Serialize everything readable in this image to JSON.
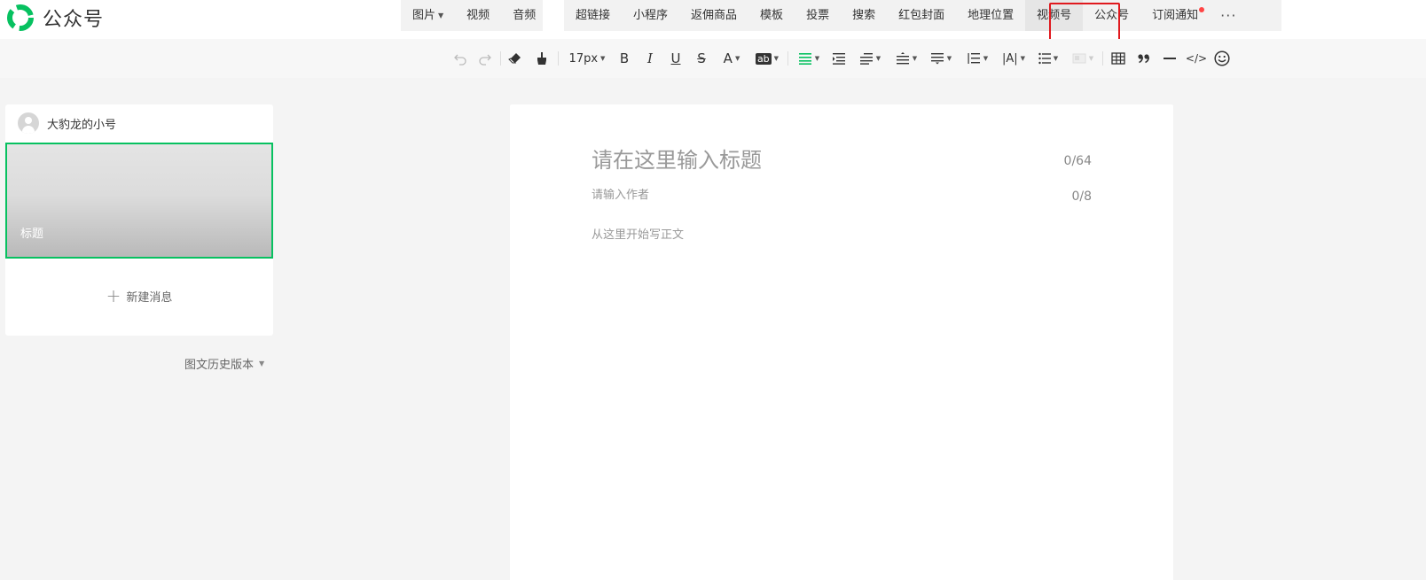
{
  "app": {
    "name": "公众号"
  },
  "insert_menu": {
    "group1": [
      {
        "label": "图片",
        "has_dropdown": true
      },
      {
        "label": "视频",
        "has_dropdown": false
      },
      {
        "label": "音频",
        "has_dropdown": false
      }
    ],
    "group2": [
      {
        "label": "超链接"
      },
      {
        "label": "小程序"
      },
      {
        "label": "返佣商品"
      },
      {
        "label": "模板"
      },
      {
        "label": "投票"
      },
      {
        "label": "搜索"
      },
      {
        "label": "红包封面"
      },
      {
        "label": "地理位置"
      },
      {
        "label": "视频号",
        "active": true
      },
      {
        "label": "公众号"
      },
      {
        "label": "订阅通知",
        "badge": "red-dot"
      }
    ],
    "more_label": "···"
  },
  "toolbar": {
    "font_size": "17px",
    "icons": [
      "undo-icon",
      "redo-icon",
      "eraser-icon",
      "format-brush-icon",
      "bold-icon",
      "italic-icon",
      "underline-icon",
      "strikethrough-icon",
      "font-color-icon",
      "background-color-icon",
      "align-icon",
      "indent-icon",
      "first-line-indent-icon",
      "paragraph-spacing-before-icon",
      "paragraph-spacing-after-icon",
      "line-height-icon",
      "letter-spacing-icon",
      "list-icon",
      "image-layout-icon",
      "table-icon",
      "quote-icon",
      "divider-icon",
      "code-icon",
      "emoji-icon"
    ],
    "labels": {
      "bold": "B",
      "italic": "I",
      "underline": "U",
      "strike": "S",
      "font_color": "A",
      "bg_color": "ab",
      "letter_spacing": "|A|",
      "code": "</>"
    },
    "accent_color": "#07c160"
  },
  "account": {
    "name": "大豹龙的小号"
  },
  "article": {
    "title": "标题"
  },
  "new_message": {
    "label": "新建消息"
  },
  "history": {
    "label": "图文历史版本"
  },
  "editor": {
    "title_placeholder": "请在这里输入标题",
    "title_count": "0/64",
    "author_placeholder": "请输入作者",
    "author_count": "0/8",
    "body_placeholder": "从这里开始写正文"
  },
  "colors": {
    "brand": "#07c160",
    "highlight": "#e0191e"
  }
}
